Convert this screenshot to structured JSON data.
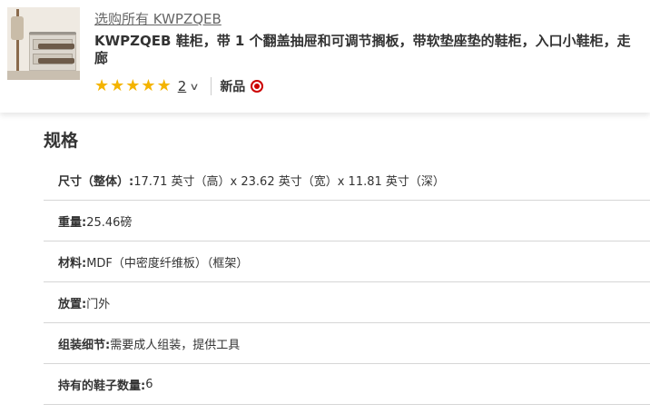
{
  "header": {
    "shop_link": "选购所有 KWPZQEB",
    "title_line1": "KWPZQEB 鞋柜，带 1 个翻盖抽屉和可调节搁板，带软垫座垫的鞋柜，入口小鞋柜，走",
    "title_line2": "廊",
    "rating": {
      "value": 5,
      "max": 5,
      "review_count": "2"
    },
    "badge": "新品",
    "icon_names": [
      "star-icon",
      "chevron-down-icon",
      "target-bullseye-icon"
    ],
    "colors": {
      "star": "#f4b400",
      "bullseye": "#cc0000"
    }
  },
  "specs": {
    "title": "规格",
    "rows": [
      {
        "key": "尺寸（整体）:",
        "value": " 17.71 英寸（高）x 23.62 英寸（宽）x 11.81 英寸（深）"
      },
      {
        "key": "重量:",
        "value": " 25.46磅"
      },
      {
        "key": "材料:",
        "value": " MDF（中密度纤维板）（框架）"
      },
      {
        "key": "放置:",
        "value": " 门外"
      },
      {
        "key": "组装细节:",
        "value": " 需要成人组装，提供工具"
      },
      {
        "key": "持有的鞋子数量:",
        "value": " 6"
      }
    ]
  }
}
